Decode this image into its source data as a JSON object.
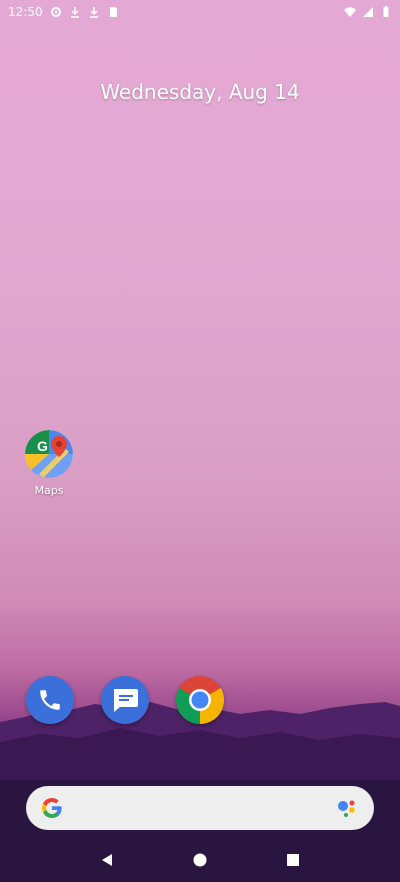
{
  "status_bar": {
    "time": "12:50",
    "icons": [
      "settings-icon",
      "download-icon",
      "download-icon",
      "sd-card-icon",
      "wifi-icon",
      "signal-icon",
      "battery-icon"
    ]
  },
  "widget": {
    "date": "Wednesday, Aug 14"
  },
  "desktop_apps": [
    {
      "label": "Maps",
      "icon": "google-maps-icon"
    }
  ],
  "dock": [
    {
      "icon": "phone-icon",
      "color": "#3b6fd9"
    },
    {
      "icon": "messages-icon",
      "color": "#3b6fd9"
    },
    {
      "icon": "chrome-icon"
    }
  ],
  "search": {
    "logo": "google-g-icon",
    "assistant": "google-assistant-icon"
  },
  "navigation": [
    "back-button",
    "home-button",
    "recents-button"
  ],
  "colors": {
    "wallpaper_top": "#e4a8d4",
    "wallpaper_bottom": "#2a1440",
    "dock_blue": "#3b6fd9",
    "search_bg": "#eeeeee"
  }
}
